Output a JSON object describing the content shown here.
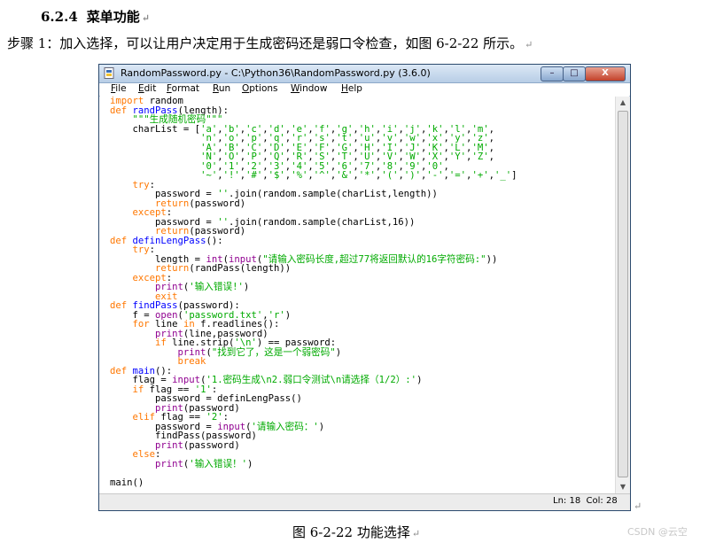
{
  "heading": {
    "number": "6.2.4",
    "title": "菜单功能"
  },
  "paragraph": "步骤 1：加入选择，可以让用户决定用于生成密码还是弱口令检查，如图 6-2-22 所示。",
  "window": {
    "title": "RandomPassword.py - C:\\Python36\\RandomPassword.py (3.6.0)",
    "minimize_glyph": "–",
    "maximize_glyph": "□",
    "close_glyph": "X",
    "menu": [
      "File",
      "Edit",
      "Format",
      "Run",
      "Options",
      "Window",
      "Help"
    ],
    "status": {
      "line": "Ln: 18",
      "col": "Col: 28"
    }
  },
  "code_lines": [
    [
      [
        "kw",
        "import"
      ],
      [
        "p",
        " random"
      ]
    ],
    [
      [
        "kw",
        "def"
      ],
      [
        "p",
        " "
      ],
      [
        "df",
        "randPass"
      ],
      [
        "p",
        "(length):"
      ]
    ],
    [
      [
        "p",
        "    "
      ],
      [
        "st",
        "\"\"\"生成随机密码\"\"\""
      ]
    ],
    [
      [
        "p",
        "    charList = ["
      ],
      [
        "st",
        "'a'"
      ],
      [
        "p",
        ","
      ],
      [
        "st",
        "'b'"
      ],
      [
        "p",
        ","
      ],
      [
        "st",
        "'c'"
      ],
      [
        "p",
        ","
      ],
      [
        "st",
        "'d'"
      ],
      [
        "p",
        ","
      ],
      [
        "st",
        "'e'"
      ],
      [
        "p",
        ","
      ],
      [
        "st",
        "'f'"
      ],
      [
        "p",
        ","
      ],
      [
        "st",
        "'g'"
      ],
      [
        "p",
        ","
      ],
      [
        "st",
        "'h'"
      ],
      [
        "p",
        ","
      ],
      [
        "st",
        "'i'"
      ],
      [
        "p",
        ","
      ],
      [
        "st",
        "'j'"
      ],
      [
        "p",
        ","
      ],
      [
        "st",
        "'k'"
      ],
      [
        "p",
        ","
      ],
      [
        "st",
        "'l'"
      ],
      [
        "p",
        ","
      ],
      [
        "st",
        "'m'"
      ],
      [
        "p",
        ","
      ]
    ],
    [
      [
        "p",
        "                "
      ],
      [
        "st",
        "'n'"
      ],
      [
        "p",
        ","
      ],
      [
        "st",
        "'o'"
      ],
      [
        "p",
        ","
      ],
      [
        "st",
        "'p'"
      ],
      [
        "p",
        ","
      ],
      [
        "st",
        "'q'"
      ],
      [
        "p",
        ","
      ],
      [
        "st",
        "'r'"
      ],
      [
        "p",
        ","
      ],
      [
        "st",
        "'s'"
      ],
      [
        "p",
        ","
      ],
      [
        "st",
        "'t'"
      ],
      [
        "p",
        ","
      ],
      [
        "st",
        "'u'"
      ],
      [
        "p",
        ","
      ],
      [
        "st",
        "'v'"
      ],
      [
        "p",
        ","
      ],
      [
        "st",
        "'w'"
      ],
      [
        "p",
        ","
      ],
      [
        "st",
        "'x'"
      ],
      [
        "p",
        ","
      ],
      [
        "st",
        "'y'"
      ],
      [
        "p",
        ","
      ],
      [
        "st",
        "'z'"
      ],
      [
        "p",
        ","
      ]
    ],
    [
      [
        "p",
        "                "
      ],
      [
        "st",
        "'A'"
      ],
      [
        "p",
        ","
      ],
      [
        "st",
        "'B'"
      ],
      [
        "p",
        ","
      ],
      [
        "st",
        "'C'"
      ],
      [
        "p",
        ","
      ],
      [
        "st",
        "'D'"
      ],
      [
        "p",
        ","
      ],
      [
        "st",
        "'E'"
      ],
      [
        "p",
        ","
      ],
      [
        "st",
        "'F'"
      ],
      [
        "p",
        ","
      ],
      [
        "st",
        "'G'"
      ],
      [
        "p",
        ","
      ],
      [
        "st",
        "'H'"
      ],
      [
        "p",
        ","
      ],
      [
        "st",
        "'I'"
      ],
      [
        "p",
        ","
      ],
      [
        "st",
        "'J'"
      ],
      [
        "p",
        ","
      ],
      [
        "st",
        "'K'"
      ],
      [
        "p",
        ","
      ],
      [
        "st",
        "'L'"
      ],
      [
        "p",
        ","
      ],
      [
        "st",
        "'M'"
      ],
      [
        "p",
        ","
      ]
    ],
    [
      [
        "p",
        "                "
      ],
      [
        "st",
        "'N'"
      ],
      [
        "p",
        ","
      ],
      [
        "st",
        "'O'"
      ],
      [
        "p",
        ","
      ],
      [
        "st",
        "'P'"
      ],
      [
        "p",
        ","
      ],
      [
        "st",
        "'Q'"
      ],
      [
        "p",
        ","
      ],
      [
        "st",
        "'R'"
      ],
      [
        "p",
        ","
      ],
      [
        "st",
        "'S'"
      ],
      [
        "p",
        ","
      ],
      [
        "st",
        "'T'"
      ],
      [
        "p",
        ","
      ],
      [
        "st",
        "'U'"
      ],
      [
        "p",
        ","
      ],
      [
        "st",
        "'V'"
      ],
      [
        "p",
        ","
      ],
      [
        "st",
        "'W'"
      ],
      [
        "p",
        ","
      ],
      [
        "st",
        "'X'"
      ],
      [
        "p",
        ","
      ],
      [
        "st",
        "'Y'"
      ],
      [
        "p",
        ","
      ],
      [
        "st",
        "'Z'"
      ],
      [
        "p",
        ","
      ]
    ],
    [
      [
        "p",
        "                "
      ],
      [
        "st",
        "'0'"
      ],
      [
        "p",
        ","
      ],
      [
        "st",
        "'1'"
      ],
      [
        "p",
        ","
      ],
      [
        "st",
        "'2'"
      ],
      [
        "p",
        ","
      ],
      [
        "st",
        "'3'"
      ],
      [
        "p",
        ","
      ],
      [
        "st",
        "'4'"
      ],
      [
        "p",
        ","
      ],
      [
        "st",
        "'5'"
      ],
      [
        "p",
        ","
      ],
      [
        "st",
        "'6'"
      ],
      [
        "p",
        ","
      ],
      [
        "st",
        "'7'"
      ],
      [
        "p",
        ","
      ],
      [
        "st",
        "'8'"
      ],
      [
        "p",
        ","
      ],
      [
        "st",
        "'9'"
      ],
      [
        "p",
        ","
      ],
      [
        "st",
        "'0'"
      ],
      [
        "p",
        ","
      ]
    ],
    [
      [
        "p",
        "                "
      ],
      [
        "st",
        "'~'"
      ],
      [
        "p",
        ","
      ],
      [
        "st",
        "'!'"
      ],
      [
        "p",
        ","
      ],
      [
        "st",
        "'#'"
      ],
      [
        "p",
        ","
      ],
      [
        "st",
        "'$'"
      ],
      [
        "p",
        ","
      ],
      [
        "st",
        "'%'"
      ],
      [
        "p",
        ","
      ],
      [
        "st",
        "'^'"
      ],
      [
        "p",
        ","
      ],
      [
        "st",
        "'&'"
      ],
      [
        "p",
        ","
      ],
      [
        "st",
        "'*'"
      ],
      [
        "p",
        ","
      ],
      [
        "st",
        "'('"
      ],
      [
        "p",
        ","
      ],
      [
        "st",
        "')'"
      ],
      [
        "p",
        ","
      ],
      [
        "st",
        "'-'"
      ],
      [
        "p",
        ","
      ],
      [
        "st",
        "'='"
      ],
      [
        "p",
        ","
      ],
      [
        "st",
        "'+'"
      ],
      [
        "p",
        ","
      ],
      [
        "st",
        "'_'"
      ],
      [
        "p",
        "]"
      ]
    ],
    [
      [
        "p",
        "    "
      ],
      [
        "kw",
        "try"
      ],
      [
        "p",
        ":"
      ]
    ],
    [
      [
        "p",
        "        password = "
      ],
      [
        "st",
        "''"
      ],
      [
        "p",
        ".join(random.sample(charList,length))"
      ]
    ],
    [
      [
        "p",
        "        "
      ],
      [
        "kw",
        "return"
      ],
      [
        "p",
        "(password)"
      ]
    ],
    [
      [
        "p",
        "    "
      ],
      [
        "kw",
        "except"
      ],
      [
        "p",
        ":"
      ]
    ],
    [
      [
        "p",
        "        password = "
      ],
      [
        "st",
        "''"
      ],
      [
        "p",
        ".join(random.sample(charList,16))"
      ]
    ],
    [
      [
        "p",
        "        "
      ],
      [
        "kw",
        "return"
      ],
      [
        "p",
        "(password)"
      ]
    ],
    [
      [
        "kw",
        "def"
      ],
      [
        "p",
        " "
      ],
      [
        "df",
        "definLengPass"
      ],
      [
        "p",
        "():"
      ]
    ],
    [
      [
        "p",
        "    "
      ],
      [
        "kw",
        "try"
      ],
      [
        "p",
        ":"
      ]
    ],
    [
      [
        "p",
        "        length = "
      ],
      [
        "bi",
        "int"
      ],
      [
        "p",
        "("
      ],
      [
        "bi",
        "input"
      ],
      [
        "p",
        "("
      ],
      [
        "st",
        "\"请输入密码长度,超过77将返回默认的16字符密码:\""
      ],
      [
        "p",
        "))"
      ]
    ],
    [
      [
        "p",
        "        "
      ],
      [
        "kw",
        "return"
      ],
      [
        "p",
        "(randPass(length))"
      ]
    ],
    [
      [
        "p",
        "    "
      ],
      [
        "kw",
        "except"
      ],
      [
        "p",
        ":"
      ]
    ],
    [
      [
        "p",
        "        "
      ],
      [
        "bi",
        "print"
      ],
      [
        "p",
        "("
      ],
      [
        "st",
        "'输入错误!'"
      ],
      [
        "p",
        ")"
      ]
    ],
    [
      [
        "p",
        "        "
      ],
      [
        "kw",
        "exit"
      ]
    ],
    [
      [
        "kw",
        "def"
      ],
      [
        "p",
        " "
      ],
      [
        "df",
        "findPass"
      ],
      [
        "p",
        "(password):"
      ]
    ],
    [
      [
        "p",
        "    f = "
      ],
      [
        "bi",
        "open"
      ],
      [
        "p",
        "("
      ],
      [
        "st",
        "'password.txt'"
      ],
      [
        "p",
        ","
      ],
      [
        "st",
        "'r'"
      ],
      [
        "p",
        ")"
      ]
    ],
    [
      [
        "p",
        "    "
      ],
      [
        "kw",
        "for"
      ],
      [
        "p",
        " line "
      ],
      [
        "kw",
        "in"
      ],
      [
        "p",
        " f.readlines():"
      ]
    ],
    [
      [
        "p",
        "        "
      ],
      [
        "bi",
        "print"
      ],
      [
        "p",
        "(line,password)"
      ]
    ],
    [
      [
        "p",
        "        "
      ],
      [
        "kw",
        "if"
      ],
      [
        "p",
        " line.strip("
      ],
      [
        "st",
        "'\\n'"
      ],
      [
        "p",
        ") == password:"
      ]
    ],
    [
      [
        "p",
        "            "
      ],
      [
        "bi",
        "print"
      ],
      [
        "p",
        "("
      ],
      [
        "st",
        "\"找到它了，这是一个弱密码\""
      ],
      [
        "p",
        ")"
      ]
    ],
    [
      [
        "p",
        "            "
      ],
      [
        "kw",
        "break"
      ]
    ],
    [
      [
        "kw",
        "def"
      ],
      [
        "p",
        " "
      ],
      [
        "df",
        "main"
      ],
      [
        "p",
        "():"
      ]
    ],
    [
      [
        "p",
        "    flag = "
      ],
      [
        "bi",
        "input"
      ],
      [
        "p",
        "("
      ],
      [
        "st",
        "'1.密码生成\\n2.弱口令测试\\n请选择（1/2）:'"
      ],
      [
        "p",
        ")"
      ]
    ],
    [
      [
        "p",
        "    "
      ],
      [
        "kw",
        "if"
      ],
      [
        "p",
        " flag == "
      ],
      [
        "st",
        "'1'"
      ],
      [
        "p",
        ":"
      ]
    ],
    [
      [
        "p",
        "        password = definLengPass()"
      ]
    ],
    [
      [
        "p",
        "        "
      ],
      [
        "bi",
        "print"
      ],
      [
        "p",
        "(password)"
      ]
    ],
    [
      [
        "p",
        "    "
      ],
      [
        "kw",
        "elif"
      ],
      [
        "p",
        " flag == "
      ],
      [
        "st",
        "'2'"
      ],
      [
        "p",
        ":"
      ]
    ],
    [
      [
        "p",
        "        password = "
      ],
      [
        "bi",
        "input"
      ],
      [
        "p",
        "("
      ],
      [
        "st",
        "'请输入密码：'"
      ],
      [
        "p",
        ")"
      ]
    ],
    [
      [
        "p",
        "        findPass(password)"
      ]
    ],
    [
      [
        "p",
        "        "
      ],
      [
        "bi",
        "print"
      ],
      [
        "p",
        "(password)"
      ]
    ],
    [
      [
        "p",
        "    "
      ],
      [
        "kw",
        "else"
      ],
      [
        "p",
        ":"
      ]
    ],
    [
      [
        "p",
        "        "
      ],
      [
        "bi",
        "print"
      ],
      [
        "p",
        "("
      ],
      [
        "st",
        "'输入错误！'"
      ],
      [
        "p",
        ")"
      ]
    ],
    [
      [
        "p",
        ""
      ]
    ],
    [
      [
        "p",
        "main()"
      ]
    ]
  ],
  "caption": "图 6-2-22  功能选择",
  "watermark": "CSDN @云空",
  "paragraph_mark": "↵",
  "colors": {
    "keyword": "#ff7700",
    "builtin": "#900090",
    "string": "#00aa00",
    "definition": "#0000ff"
  }
}
